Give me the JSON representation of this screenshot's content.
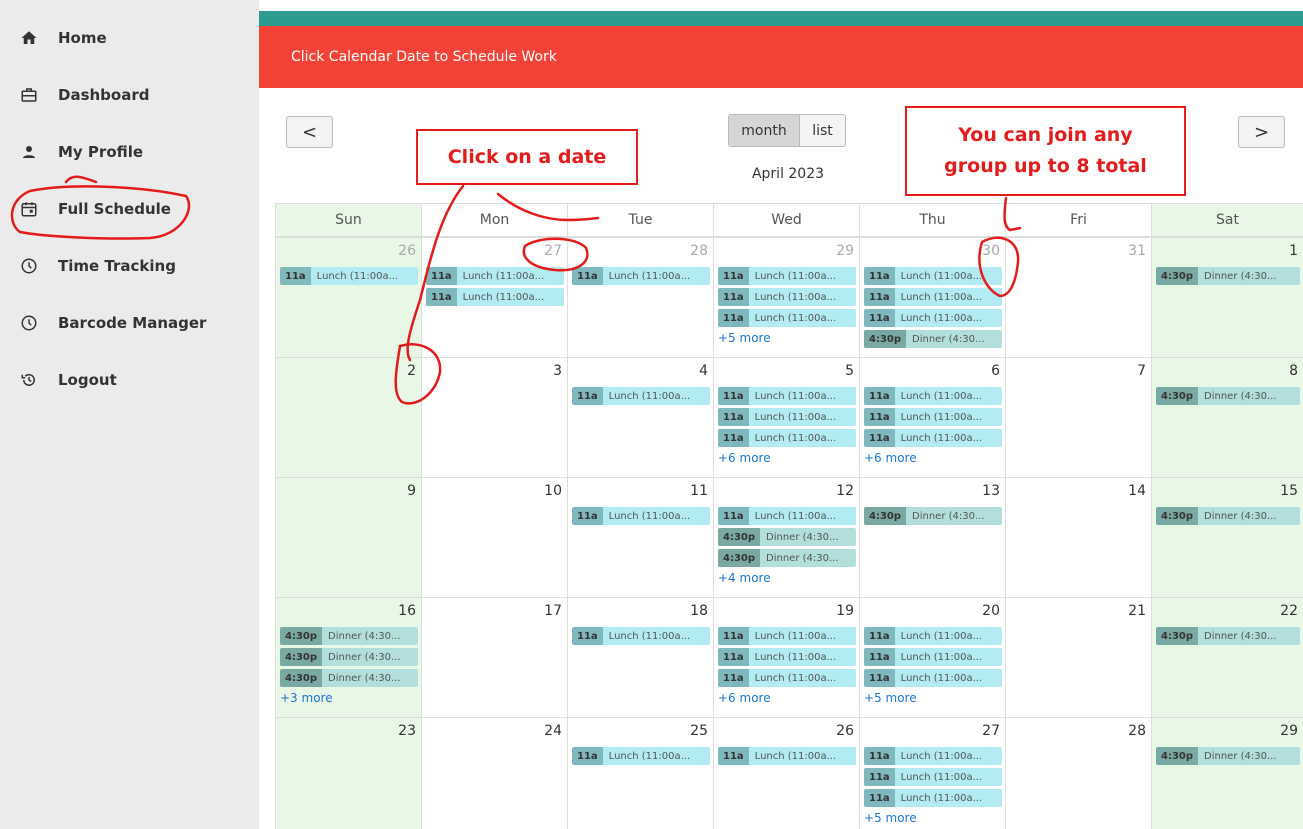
{
  "sidebar": {
    "items": [
      {
        "label": "Home",
        "icon": "home-icon"
      },
      {
        "label": "Dashboard",
        "icon": "briefcase-icon"
      },
      {
        "label": "My Profile",
        "icon": "person-icon"
      },
      {
        "label": "Full Schedule",
        "icon": "calendar-icon"
      },
      {
        "label": "Time Tracking",
        "icon": "clock-icon"
      },
      {
        "label": "Barcode Manager",
        "icon": "clock-icon"
      },
      {
        "label": "Logout",
        "icon": "history-icon"
      }
    ]
  },
  "banner": {
    "text": "Click Calendar Date to Schedule Work"
  },
  "toolbar": {
    "prev": "<",
    "next": ">",
    "month": "month",
    "list": "list",
    "title": "April 2023"
  },
  "annotations": {
    "click_date": "Click on a date",
    "join_group_line1": "You can join any",
    "join_group_line2": "group up to 8 total"
  },
  "calendar": {
    "days_of_week": [
      "Sun",
      "Mon",
      "Tue",
      "Wed",
      "Thu",
      "Fri",
      "Sat"
    ],
    "weeks": [
      [
        {
          "day": "26",
          "other": true,
          "events": [
            {
              "t": "11a",
              "x": "Lunch (11:00a...",
              "k": "lunch"
            }
          ]
        },
        {
          "day": "27",
          "other": true,
          "events": [
            {
              "t": "11a",
              "x": "Lunch (11:00a...",
              "k": "lunch"
            },
            {
              "t": "11a",
              "x": "Lunch (11:00a...",
              "k": "lunch"
            }
          ]
        },
        {
          "day": "28",
          "other": true,
          "events": [
            {
              "t": "11a",
              "x": "Lunch (11:00a...",
              "k": "lunch"
            }
          ]
        },
        {
          "day": "29",
          "other": true,
          "events": [
            {
              "t": "11a",
              "x": "Lunch (11:00a...",
              "k": "lunch"
            },
            {
              "t": "11a",
              "x": "Lunch (11:00a...",
              "k": "lunch"
            },
            {
              "t": "11a",
              "x": "Lunch (11:00a...",
              "k": "lunch"
            }
          ],
          "more": "+5 more"
        },
        {
          "day": "30",
          "other": true,
          "events": [
            {
              "t": "11a",
              "x": "Lunch (11:00a...",
              "k": "lunch"
            },
            {
              "t": "11a",
              "x": "Lunch (11:00a...",
              "k": "lunch"
            },
            {
              "t": "11a",
              "x": "Lunch (11:00a...",
              "k": "lunch"
            },
            {
              "t": "4:30p",
              "x": "Dinner (4:30...",
              "k": "dinner"
            }
          ]
        },
        {
          "day": "31",
          "other": true,
          "events": []
        },
        {
          "day": "1",
          "other": false,
          "events": [
            {
              "t": "4:30p",
              "x": "Dinner (4:30...",
              "k": "dinner"
            }
          ]
        }
      ],
      [
        {
          "day": "2",
          "other": false,
          "events": []
        },
        {
          "day": "3",
          "other": false,
          "events": []
        },
        {
          "day": "4",
          "other": false,
          "events": [
            {
              "t": "11a",
              "x": "Lunch (11:00a...",
              "k": "lunch"
            }
          ]
        },
        {
          "day": "5",
          "other": false,
          "events": [
            {
              "t": "11a",
              "x": "Lunch (11:00a...",
              "k": "lunch"
            },
            {
              "t": "11a",
              "x": "Lunch (11:00a...",
              "k": "lunch"
            },
            {
              "t": "11a",
              "x": "Lunch (11:00a...",
              "k": "lunch"
            }
          ],
          "more": "+6 more"
        },
        {
          "day": "6",
          "other": false,
          "events": [
            {
              "t": "11a",
              "x": "Lunch (11:00a...",
              "k": "lunch"
            },
            {
              "t": "11a",
              "x": "Lunch (11:00a...",
              "k": "lunch"
            },
            {
              "t": "11a",
              "x": "Lunch (11:00a...",
              "k": "lunch"
            }
          ],
          "more": "+6 more"
        },
        {
          "day": "7",
          "other": false,
          "events": []
        },
        {
          "day": "8",
          "other": false,
          "events": [
            {
              "t": "4:30p",
              "x": "Dinner (4:30...",
              "k": "dinner"
            }
          ]
        }
      ],
      [
        {
          "day": "9",
          "other": false,
          "events": []
        },
        {
          "day": "10",
          "other": false,
          "events": []
        },
        {
          "day": "11",
          "other": false,
          "events": [
            {
              "t": "11a",
              "x": "Lunch (11:00a...",
              "k": "lunch"
            }
          ]
        },
        {
          "day": "12",
          "other": false,
          "events": [
            {
              "t": "11a",
              "x": "Lunch (11:00a...",
              "k": "lunch"
            },
            {
              "t": "4:30p",
              "x": "Dinner (4:30...",
              "k": "dinner"
            },
            {
              "t": "4:30p",
              "x": "Dinner (4:30...",
              "k": "dinner"
            }
          ],
          "more": "+4 more"
        },
        {
          "day": "13",
          "other": false,
          "events": [
            {
              "t": "4:30p",
              "x": "Dinner (4:30...",
              "k": "dinner"
            }
          ]
        },
        {
          "day": "14",
          "other": false,
          "events": []
        },
        {
          "day": "15",
          "other": false,
          "events": [
            {
              "t": "4:30p",
              "x": "Dinner (4:30...",
              "k": "dinner"
            }
          ]
        }
      ],
      [
        {
          "day": "16",
          "other": false,
          "events": [
            {
              "t": "4:30p",
              "x": "Dinner (4:30...",
              "k": "dinner"
            },
            {
              "t": "4:30p",
              "x": "Dinner (4:30...",
              "k": "dinner"
            },
            {
              "t": "4:30p",
              "x": "Dinner (4:30...",
              "k": "dinner"
            }
          ],
          "more": "+3 more"
        },
        {
          "day": "17",
          "other": false,
          "events": []
        },
        {
          "day": "18",
          "other": false,
          "events": [
            {
              "t": "11a",
              "x": "Lunch (11:00a...",
              "k": "lunch"
            }
          ]
        },
        {
          "day": "19",
          "other": false,
          "events": [
            {
              "t": "11a",
              "x": "Lunch (11:00a...",
              "k": "lunch"
            },
            {
              "t": "11a",
              "x": "Lunch (11:00a...",
              "k": "lunch"
            },
            {
              "t": "11a",
              "x": "Lunch (11:00a...",
              "k": "lunch"
            }
          ],
          "more": "+6 more"
        },
        {
          "day": "20",
          "other": false,
          "events": [
            {
              "t": "11a",
              "x": "Lunch (11:00a...",
              "k": "lunch"
            },
            {
              "t": "11a",
              "x": "Lunch (11:00a...",
              "k": "lunch"
            },
            {
              "t": "11a",
              "x": "Lunch (11:00a...",
              "k": "lunch"
            }
          ],
          "more": "+5 more"
        },
        {
          "day": "21",
          "other": false,
          "events": []
        },
        {
          "day": "22",
          "other": false,
          "events": [
            {
              "t": "4:30p",
              "x": "Dinner (4:30...",
              "k": "dinner"
            }
          ]
        }
      ],
      [
        {
          "day": "23",
          "other": false,
          "events": []
        },
        {
          "day": "24",
          "other": false,
          "events": []
        },
        {
          "day": "25",
          "other": false,
          "events": [
            {
              "t": "11a",
              "x": "Lunch (11:00a...",
              "k": "lunch"
            }
          ]
        },
        {
          "day": "26",
          "other": false,
          "events": [
            {
              "t": "11a",
              "x": "Lunch (11:00a...",
              "k": "lunch"
            }
          ]
        },
        {
          "day": "27",
          "other": false,
          "events": [
            {
              "t": "11a",
              "x": "Lunch (11:00a...",
              "k": "lunch"
            },
            {
              "t": "11a",
              "x": "Lunch (11:00a...",
              "k": "lunch"
            },
            {
              "t": "11a",
              "x": "Lunch (11:00a...",
              "k": "lunch"
            }
          ],
          "more": "+5 more"
        },
        {
          "day": "28",
          "other": false,
          "events": []
        },
        {
          "day": "29",
          "other": false,
          "events": [
            {
              "t": "4:30p",
              "x": "Dinner (4:30...",
              "k": "dinner"
            }
          ]
        }
      ]
    ]
  },
  "colors": {
    "banner": "#f44336",
    "teal": "#2a9d8f",
    "weekend": "#e9f7e6",
    "lunch": "#b2ebf2",
    "dinner": "#b2dfdb",
    "annotation": "#e41b1b",
    "more_link": "#1976d2"
  }
}
